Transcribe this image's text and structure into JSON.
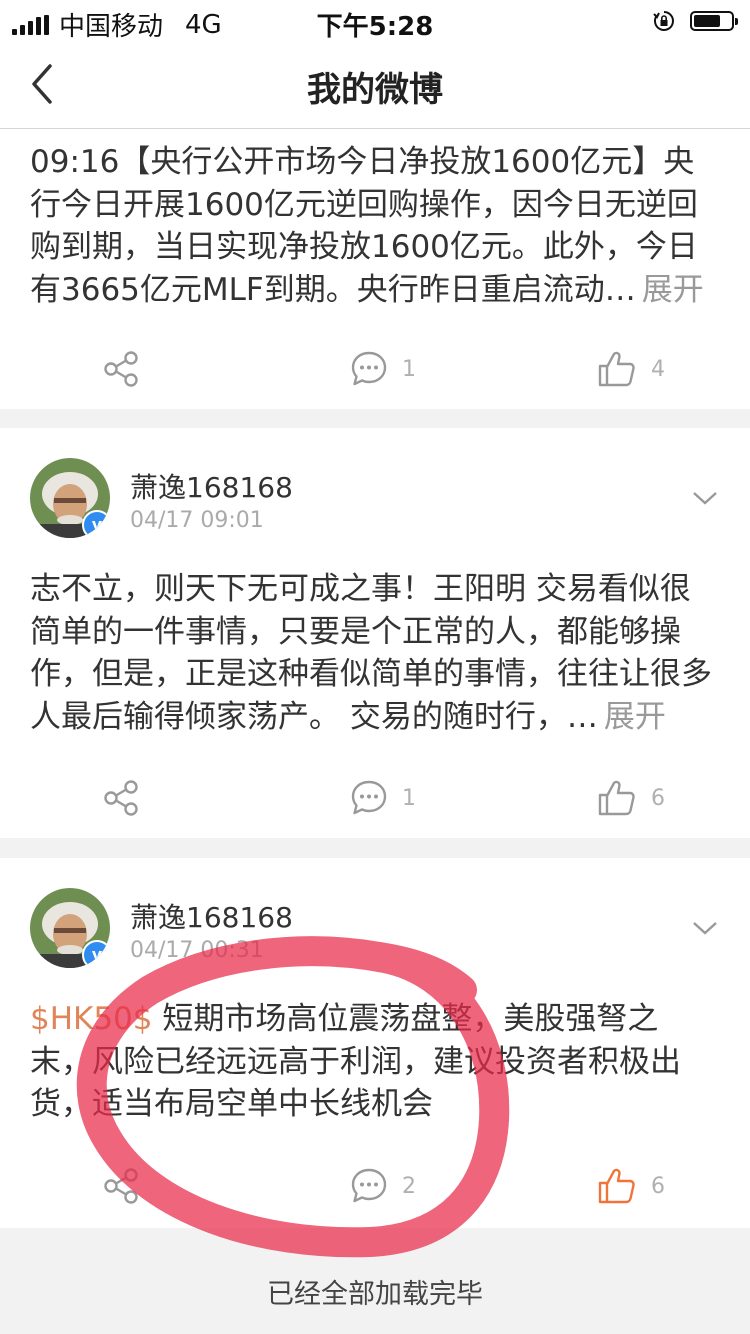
{
  "status": {
    "carrier": "中国移动",
    "network": "4G",
    "time": "下午5:28"
  },
  "nav": {
    "title": "我的微博"
  },
  "posts": [
    {
      "text": "09:16【央行公开市场今日净投放1600亿元】央行今日开展1600亿元逆回购操作，因今日无逆回购到期，当日实现净投放1600亿元。此外，今日有3665亿元MLF到期。央行昨日重启流动…",
      "expand": "展开",
      "comments": "1",
      "likes": "4"
    },
    {
      "username": "萧逸168168",
      "time": "04/17 09:01",
      "text": "志不立，则天下无可成之事！王阳明 交易看似很简单的一件事情，只要是个正常的人，都能够操作，但是，正是这种看似简单的事情，往往让很多人最后输得倾家荡产。 交易的随时行，…",
      "expand": "展开",
      "comments": "1",
      "likes": "6"
    },
    {
      "username": "萧逸168168",
      "time": "04/17 00:31",
      "topic": "$HK50$",
      "text": " 短期市场高位震荡盘整，美股强弩之末，风险已经远远高于利润，建议投资者积极出货，适当布局空单中长线机会",
      "comments": "2",
      "likes": "6"
    }
  ],
  "footer": {
    "text": "已经全部加载完毕"
  },
  "colors": {
    "topic": "#e0855a",
    "like_active": "#f0743a",
    "icon_gray": "#999999",
    "annotation": "#e8294a"
  },
  "icons": [
    "back-arrow-icon",
    "share-icon",
    "comment-icon",
    "thumbs-up-icon",
    "chevron-down-icon",
    "verified-icon",
    "lock-rotation-icon",
    "battery-icon",
    "signal-icon"
  ]
}
